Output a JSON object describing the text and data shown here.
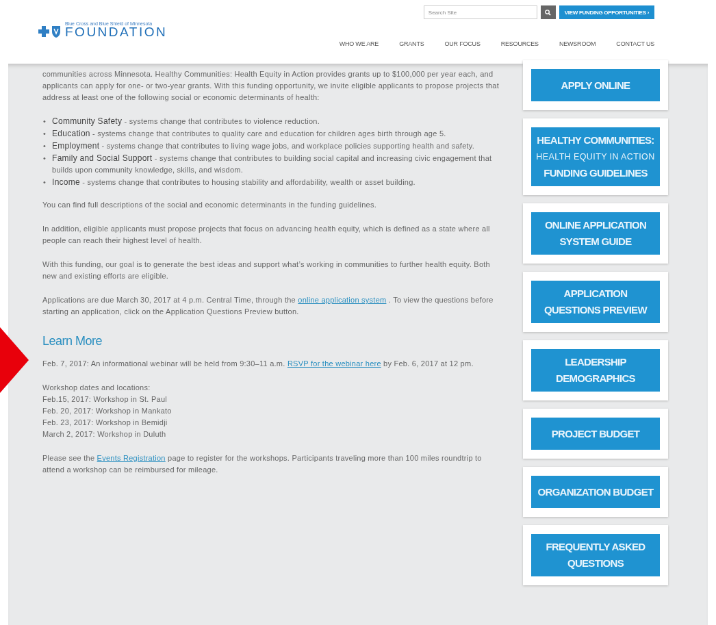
{
  "header": {
    "logo": {
      "tagline": "Blue Cross and Blue Shield of Minnesota",
      "name": "FOUNDATION"
    },
    "search": {
      "placeholder": "Search Site"
    },
    "cta": {
      "label": "VIEW FUNDING OPPORTUNITIES",
      "chevron": "›"
    },
    "nav": [
      "WHO WE ARE",
      "GRANTS",
      "OUR FOCUS",
      "RESOURCES",
      "NEWSROOM",
      "CONTACT US"
    ]
  },
  "content": {
    "intro": "communities across Minnesota. Healthy Communities: Health Equity in Action provides grants up to $100,000 per year each, and applicants can apply for one- or two-year grants. With this funding opportunity, we invite eligible applicants to propose projects that address at least one of the following social or economic determinants of health:",
    "determinants": [
      {
        "marker": "•",
        "term": "Community Safety",
        "text": " - systems change that contributes to violence reduction."
      },
      {
        "marker": "•",
        "term": "Education",
        "text": " - systems change that contributes to quality care and education for children ages birth through age 5."
      },
      {
        "marker": "•",
        "term": "Employment",
        "text": " - systems change that contributes to living wage jobs, and workplace policies supporting health and safety."
      },
      {
        "marker": "•",
        "term": "Family and Social Support",
        "text": " - systems change that contributes to building social capital and increasing civic engagement that builds upon community knowledge, skills, and wisdom."
      },
      {
        "marker": "•",
        "term": "Income",
        "text": " - systems change that contributes to housing stability and affordability, wealth or asset building."
      }
    ],
    "paragraphs": [
      [
        {
          "kind": "text",
          "text": "You can find full descriptions of the social and economic determinants in the funding guidelines."
        }
      ],
      [
        {
          "kind": "text",
          "text": "In addition, eligible applicants must propose projects that focus on advancing health equity, which is defined as a state where all people can reach their highest level of health."
        }
      ],
      [
        {
          "kind": "text",
          "text": "With this funding, our goal is to generate the best ideas and support what’s working in communities to further health equity. Both new and existing efforts are eligible."
        }
      ],
      [
        {
          "kind": "text",
          "text": "Applications are due March 30, 2017 at 4 p.m. Central Time, through the "
        },
        {
          "kind": "link",
          "text": "online application system"
        },
        {
          "kind": "text",
          "text": " . To view the questions before starting an application, click on the Application Questions Preview button."
        }
      ]
    ],
    "learn_more": {
      "heading": "Learn More",
      "webinar": [
        {
          "kind": "text",
          "text": "Feb. 7, 2017: An informational webinar will be held from 9:30–11 a.m. "
        },
        {
          "kind": "link",
          "text": "RSVP for the webinar here"
        },
        {
          "kind": "text",
          "text": " by Feb. 6, 2017 at 12 pm."
        }
      ],
      "workshops": [
        "Workshop dates and locations:",
        "Feb.15, 2017: Workshop in St. Paul",
        "Feb. 20, 2017: Workshop in Mankato",
        "Feb. 23, 2017: Workshop in Bemidji",
        "March 2, 2017: Workshop in Duluth"
      ],
      "registration": [
        {
          "kind": "text",
          "text": "Please see the "
        },
        {
          "kind": "link",
          "text": "Events Registration"
        },
        {
          "kind": "text",
          "text": " page to register for the workshops. Participants traveling more than 100 miles roundtrip to attend a workshop can be reimbursed for mileage."
        }
      ]
    }
  },
  "sidebar": [
    {
      "lines": [
        {
          "kind": "bold",
          "text": "APPLY ONLINE"
        }
      ]
    },
    {
      "lines": [
        {
          "kind": "bold",
          "text": "HEALTHY COMMUNITIES:"
        },
        {
          "kind": "light",
          "text": "HEALTH EQUITY IN ACTION"
        },
        {
          "kind": "bold",
          "text": "FUNDING GUIDELINES"
        }
      ]
    },
    {
      "lines": [
        {
          "kind": "bold",
          "text": "ONLINE APPLICATION"
        },
        {
          "kind": "bold",
          "text": "SYSTEM GUIDE"
        }
      ]
    },
    {
      "lines": [
        {
          "kind": "bold",
          "text": "APPLICATION"
        },
        {
          "kind": "bold",
          "text": "QUESTIONS PREVIEW"
        }
      ]
    },
    {
      "lines": [
        {
          "kind": "bold",
          "text": "LEADERSHIP"
        },
        {
          "kind": "bold",
          "text": "DEMOGRAPHICS"
        }
      ]
    },
    {
      "lines": [
        {
          "kind": "bold",
          "text": "PROJECT BUDGET"
        }
      ]
    },
    {
      "lines": [
        {
          "kind": "bold",
          "text": "ORGANIZATION BUDGET"
        }
      ]
    },
    {
      "lines": [
        {
          "kind": "bold",
          "text": "FREQUENTLY ASKED"
        },
        {
          "kind": "bold",
          "text": "QUESTIONS"
        }
      ]
    }
  ]
}
